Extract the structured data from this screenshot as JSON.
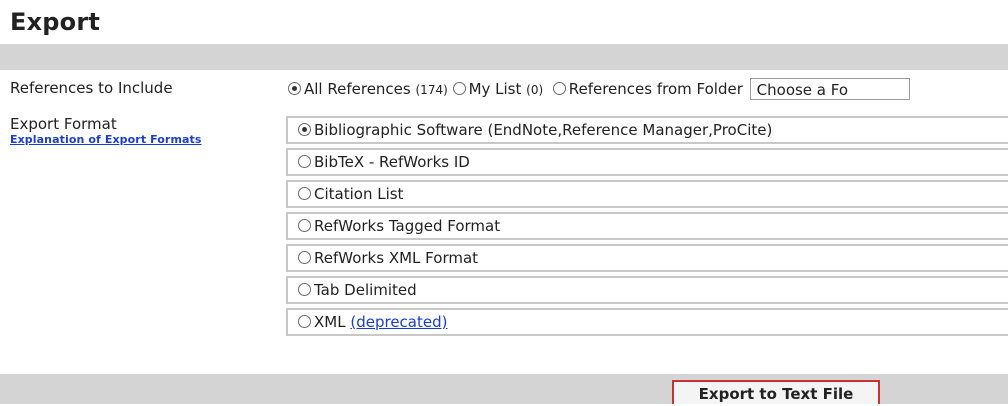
{
  "page": {
    "title": "Export"
  },
  "references": {
    "label": "References to Include",
    "options": [
      {
        "label": "All References",
        "count": "(174)",
        "checked": true
      },
      {
        "label": "My List",
        "count": "(0)",
        "checked": false
      },
      {
        "label": "References from Folder",
        "count": "",
        "checked": false
      }
    ],
    "folder_select_value": "Choose a Fo"
  },
  "export_format": {
    "label": "Export Format",
    "help_link": "Explanation of Export Formats",
    "options": [
      {
        "label": "Bibliographic Software (EndNote,Reference Manager,ProCite)",
        "checked": true
      },
      {
        "label": "BibTeX - RefWorks ID",
        "checked": false
      },
      {
        "label": "Citation List",
        "checked": false
      },
      {
        "label": "RefWorks Tagged Format",
        "checked": false
      },
      {
        "label": "RefWorks XML Format",
        "checked": false
      },
      {
        "label": "Tab Delimited",
        "checked": false
      },
      {
        "label": "XML",
        "link": "(deprecated)",
        "checked": false
      }
    ]
  },
  "actions": {
    "export_button": "Export to Text File"
  }
}
